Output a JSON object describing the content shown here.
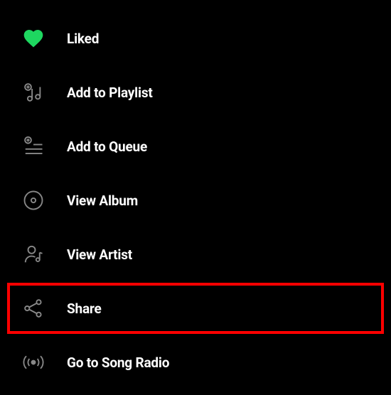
{
  "menu": {
    "items": [
      {
        "id": "liked",
        "label": "Liked",
        "highlighted": false
      },
      {
        "id": "add-to-playlist",
        "label": "Add to Playlist",
        "highlighted": false
      },
      {
        "id": "add-to-queue",
        "label": "Add to Queue",
        "highlighted": false
      },
      {
        "id": "view-album",
        "label": "View Album",
        "highlighted": false
      },
      {
        "id": "view-artist",
        "label": "View Artist",
        "highlighted": false
      },
      {
        "id": "share",
        "label": "Share",
        "highlighted": true
      },
      {
        "id": "go-to-song-radio",
        "label": "Go to Song Radio",
        "highlighted": false
      }
    ]
  },
  "colors": {
    "liked_heart": "#1ed760",
    "icon_stroke": "#888888",
    "highlight": "#ff0000"
  }
}
